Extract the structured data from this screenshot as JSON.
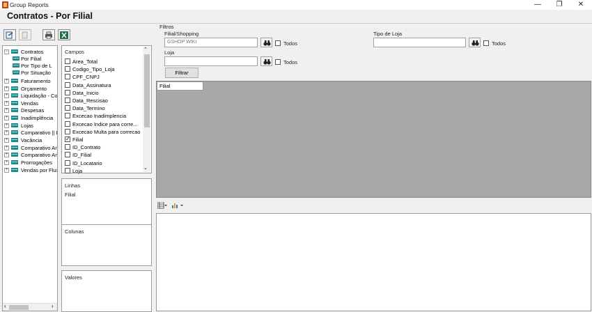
{
  "window": {
    "title": "Group Reports",
    "minimize": "—",
    "maximize": "❐",
    "close": "✕"
  },
  "page_title": "Contratos - Por Filial",
  "tree": {
    "items": [
      {
        "label": "Contratos",
        "expander": "−"
      },
      {
        "label": "Por Filial"
      },
      {
        "label": "Por Tipo de L"
      },
      {
        "label": "Por Situação"
      },
      {
        "label": "Faturamento",
        "expander": "+"
      },
      {
        "label": "Orçamento",
        "expander": "+"
      },
      {
        "label": "Liquidação - Con",
        "expander": "+"
      },
      {
        "label": "Vendas",
        "expander": "+"
      },
      {
        "label": "Despesas",
        "expander": "+"
      },
      {
        "label": "Inadimplência",
        "expander": "+"
      },
      {
        "label": "Lojas",
        "expander": "+"
      },
      {
        "label": "Comparativo || L",
        "expander": "+"
      },
      {
        "label": "Vacância",
        "expander": "+"
      },
      {
        "label": "Comparativo Anu",
        "expander": "+"
      },
      {
        "label": "Comparativo Anu",
        "expander": "+"
      },
      {
        "label": "Prorrogações",
        "expander": "+"
      },
      {
        "label": "Vendas por Fluxo",
        "expander": "+"
      }
    ]
  },
  "fields": {
    "label": "Campos",
    "items": [
      {
        "label": "Area_Total",
        "checked": false
      },
      {
        "label": "Codigo_Tipo_Loja",
        "checked": false
      },
      {
        "label": "CPF_CNPJ",
        "checked": false
      },
      {
        "label": "Data_Assinatura",
        "checked": false
      },
      {
        "label": "Data_Inicio",
        "checked": false
      },
      {
        "label": "Data_Rescisao",
        "checked": false
      },
      {
        "label": "Data_Termino",
        "checked": false
      },
      {
        "label": "Excecao Inadimplencia",
        "checked": false
      },
      {
        "label": "Excecao Indice para corre...",
        "checked": false
      },
      {
        "label": "Excecao Multa para correcao",
        "checked": false
      },
      {
        "label": "Filial",
        "checked": true
      },
      {
        "label": "ID_Contrato",
        "checked": false
      },
      {
        "label": "ID_Filial",
        "checked": false
      },
      {
        "label": "ID_Locatario",
        "checked": false
      },
      {
        "label": "Loja",
        "checked": false
      }
    ]
  },
  "rows": {
    "label": "Linhas",
    "items": [
      "Filial"
    ]
  },
  "columns": {
    "label": "Colunas"
  },
  "values": {
    "label": "Valores"
  },
  "filters": {
    "group_label": "Filtros",
    "filial_label": "Filial/Shopping",
    "filial_value": "GSHOP WIKI",
    "loja_label": "Loja",
    "loja_value": "",
    "tipo_label": "Tipo de Loja",
    "tipo_value": "",
    "todos_label": "Todos",
    "filter_button": "Filtrar"
  },
  "pivot": {
    "row_header": "Filial"
  },
  "colors": {
    "grid_bg": "#a8a8a8",
    "accent_teal": "#1d8a8a"
  }
}
